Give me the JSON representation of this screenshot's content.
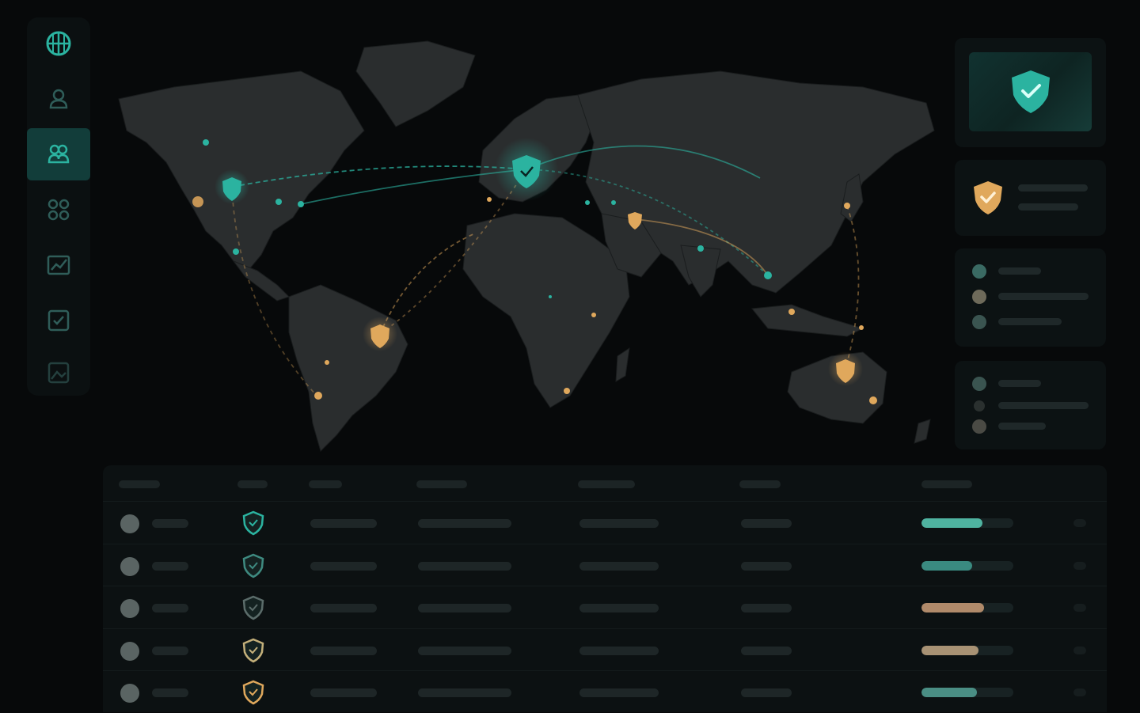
{
  "sidebar": {
    "items": [
      {
        "icon": "globe-network-icon",
        "active": false
      },
      {
        "icon": "user-shield-icon",
        "active": false
      },
      {
        "icon": "users-group-icon",
        "active": true
      },
      {
        "icon": "nodes-link-icon",
        "active": false
      },
      {
        "icon": "analytics-chart-icon",
        "active": false
      },
      {
        "icon": "document-check-icon",
        "active": false
      },
      {
        "icon": "image-report-icon",
        "active": false
      }
    ]
  },
  "colors": {
    "accent": "#2bb3a0",
    "warning": "#e0a85c",
    "panel": "#0c1213",
    "background": "#07090a"
  },
  "status_cards": [
    {
      "icon": "shield-check-icon",
      "color": "#2bb3a0"
    },
    {
      "icon": "shield-warning-icon",
      "color": "#e0a85c"
    }
  ],
  "table": {
    "rows": [
      {
        "shield_color": "#2bb3a0",
        "progress": 0.66,
        "bar_color": "#4fb3a0"
      },
      {
        "shield_color": "#3e8a80",
        "progress": 0.55,
        "bar_color": "#3a8a80"
      },
      {
        "shield_color": "#5b6c6a",
        "progress": 0.68,
        "bar_color": "#b08a6a"
      },
      {
        "shield_color": "#c4b07a",
        "progress": 0.62,
        "bar_color": "#a89274"
      },
      {
        "shield_color": "#e0a85c",
        "progress": 0.6,
        "bar_color": "#4a8e84"
      }
    ]
  }
}
